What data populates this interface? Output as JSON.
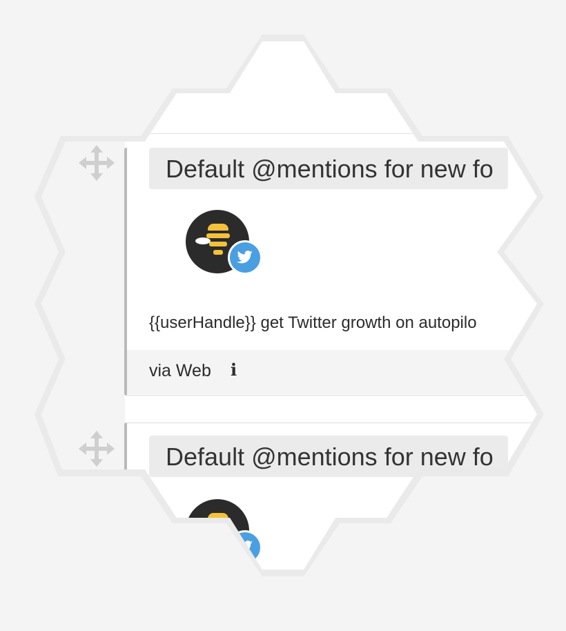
{
  "cards": [
    {
      "title": "Default @mentions for new fo",
      "tweet_text": "{{userHandle}} get Twitter growth on autopilo",
      "footer_via": "via Web",
      "info_icon": "info-icon",
      "avatar_icon": "bee-logo",
      "badge_icon": "twitter-bird-icon"
    },
    {
      "title": "Default @mentions for new fo",
      "avatar_icon": "bee-logo",
      "badge_icon": "twitter-bird-icon"
    }
  ],
  "icons": {
    "drag": "move-arrows-icon"
  },
  "colors": {
    "twitter_blue": "#4a9fe1",
    "bee_yellow": "#f4c23a",
    "card_border": "#b9b9b9"
  }
}
